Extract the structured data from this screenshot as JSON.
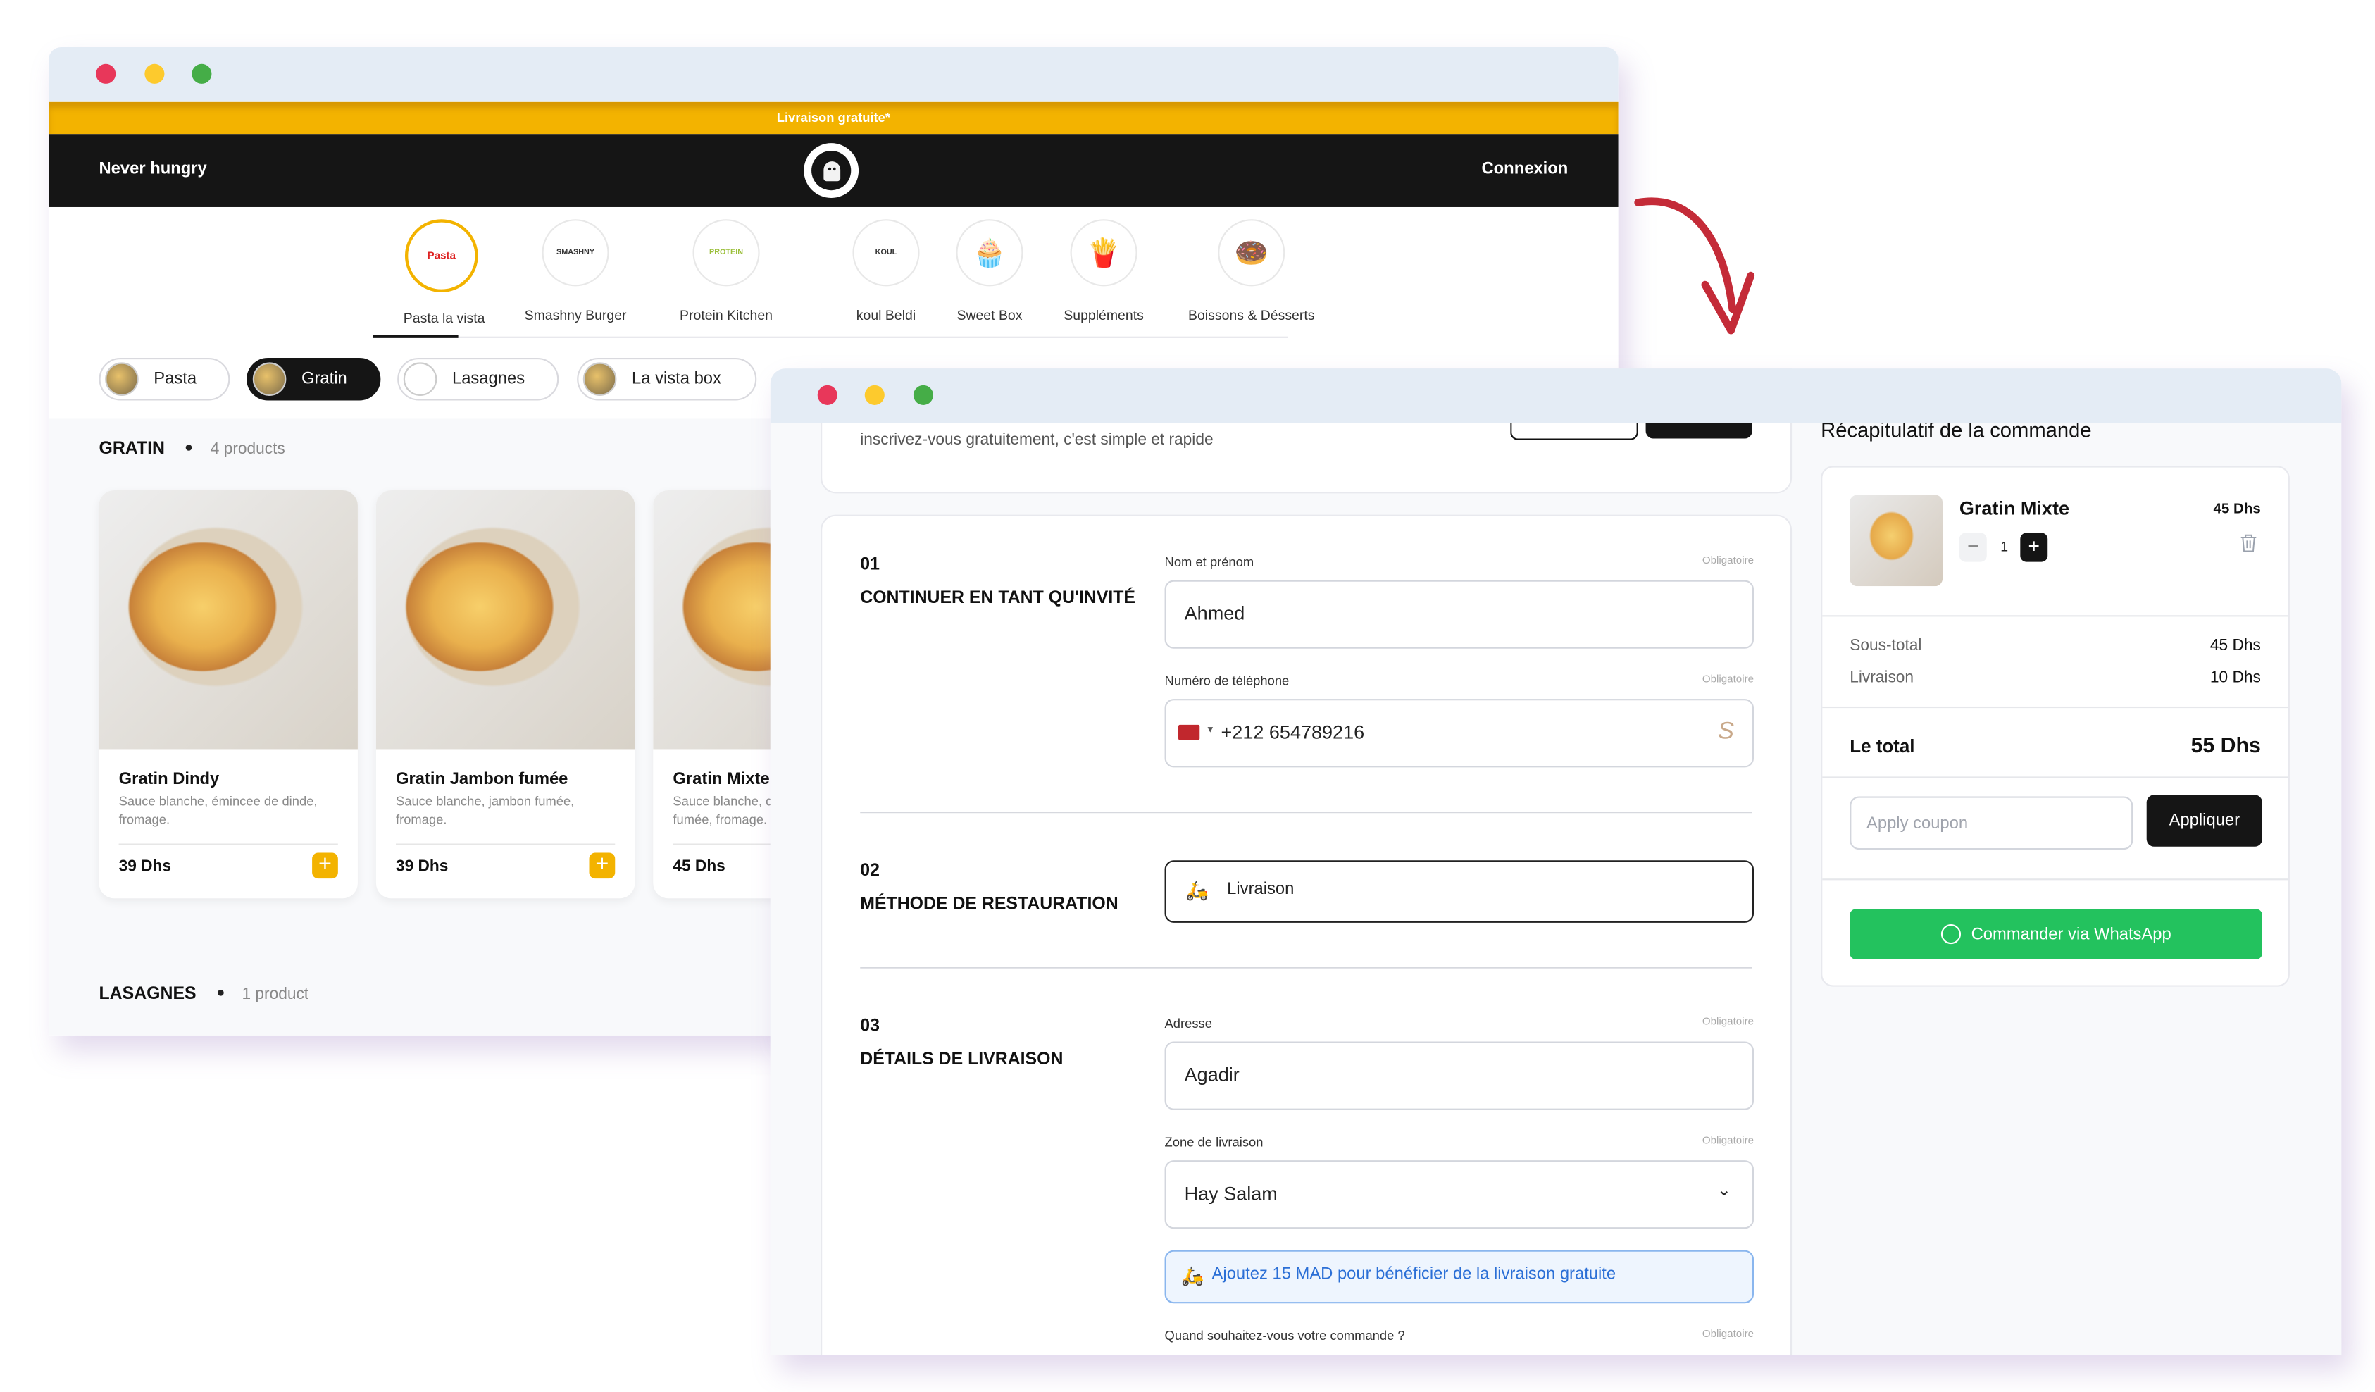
{
  "menu_window": {
    "promo_banner": "Livraison gratuite*",
    "navbar": {
      "brand": "Never hungry",
      "login": "Connexion",
      "logo_icon": "ghost-food-logo"
    },
    "brands": [
      {
        "label": "Pasta la vista",
        "logo_text": "Pasta la Vista",
        "active": true
      },
      {
        "label": "Smashny Burger",
        "logo_text": "SMASHNY"
      },
      {
        "label": "Protein Kitchen",
        "logo_text": "PROTEIN"
      },
      {
        "label": "koul Beldi",
        "logo_text": "KOUL"
      },
      {
        "label": "Sweet Box",
        "logo_text": "🧁"
      },
      {
        "label": "Suppléments",
        "logo_text": "🍟"
      },
      {
        "label": "Boissons & Désserts",
        "logo_text": "🍩"
      }
    ],
    "categories": [
      {
        "label": "Pasta"
      },
      {
        "label": "Gratin",
        "active": true
      },
      {
        "label": "Lasagnes"
      },
      {
        "label": "La vista box"
      }
    ],
    "sections": [
      {
        "title": "GRATIN",
        "count": "4 products",
        "products": [
          {
            "name": "Gratin Dindy",
            "description": "Sauce blanche, émincee de dinde, fromage.",
            "price": "39 Dhs"
          },
          {
            "name": "Gratin Jambon fumée",
            "description": "Sauce blanche, jambon fumée, fromage.",
            "price": "39 Dhs"
          },
          {
            "name": "Gratin Mixte",
            "description": "Sauce blanche, dinde, jambon fumée, fromage.",
            "price": "45 Dhs"
          }
        ]
      },
      {
        "title": "LASAGNES",
        "count": "1 product"
      }
    ]
  },
  "checkout_window": {
    "signup_text": "inscrivez-vous gratuitement, c'est simple et rapide",
    "required_label": "Obligatoire",
    "steps": [
      {
        "number": "01",
        "title": "CONTINUER EN TANT QU'INVITÉ",
        "fields": [
          {
            "label": "Nom et prénom",
            "value": "Ahmed"
          },
          {
            "label": "Numéro de téléphone",
            "value": "+212 654789216",
            "country": "MA"
          }
        ]
      },
      {
        "number": "02",
        "title": "MÉTHODE DE RESTAURATION",
        "method": "Livraison"
      },
      {
        "number": "03",
        "title": "DÉTAILS DE LIVRAISON",
        "fields": [
          {
            "label": "Adresse",
            "value": "Agadir"
          },
          {
            "label": "Zone de livraison",
            "value": "Hay Salam"
          }
        ],
        "free_delivery_notice": "Ajoutez 15 MAD pour bénéficier de la livraison gratuite",
        "when_label": "Quand souhaitez-vous votre commande ?"
      }
    ],
    "summary": {
      "title": "Récapitulatif de la commande",
      "item": {
        "name": "Gratin Mixte",
        "price": "45 Dhs",
        "quantity": "1"
      },
      "subtotal_label": "Sous-total",
      "subtotal": "45 Dhs",
      "delivery_label": "Livraison",
      "delivery": "10 Dhs",
      "total_label": "Le total",
      "total": "55 Dhs",
      "coupon_placeholder": "Apply coupon",
      "apply_label": "Appliquer",
      "whatsapp_label": "Commander via WhatsApp"
    }
  },
  "colors": {
    "accent": "#f3b300",
    "dark": "#151515",
    "whatsapp": "#23c25e",
    "arrow": "#c42b38",
    "info": "#2b6fd6"
  }
}
